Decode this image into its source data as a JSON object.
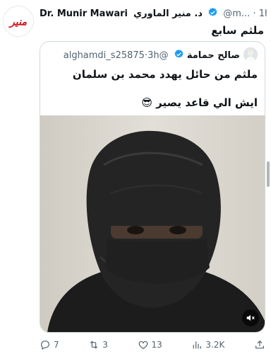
{
  "author": {
    "name_en": "Dr. Munir Mawari",
    "name_ar": "د. منير الماوري",
    "handle": "@m...",
    "dot": "·",
    "time": "1h",
    "avatar_text": "منير",
    "avatar_color": "#d0141c"
  },
  "tweet": {
    "text": "ملثم سابع"
  },
  "quote": {
    "name": "صالح حمامة",
    "handle": "@alghamdi_s25875",
    "dot": "·",
    "time": "3h",
    "line1": "ملثم من حائل يهدد محمد بن سلمان",
    "line2": "ايش الي قاعد يصير 😎"
  },
  "actions": {
    "replies": "7",
    "retweets": "3",
    "likes": "13",
    "views": "3.2K"
  },
  "colors": {
    "verified": "#1d9bf0",
    "muted_text": "#536471",
    "border": "#cfd9de"
  }
}
